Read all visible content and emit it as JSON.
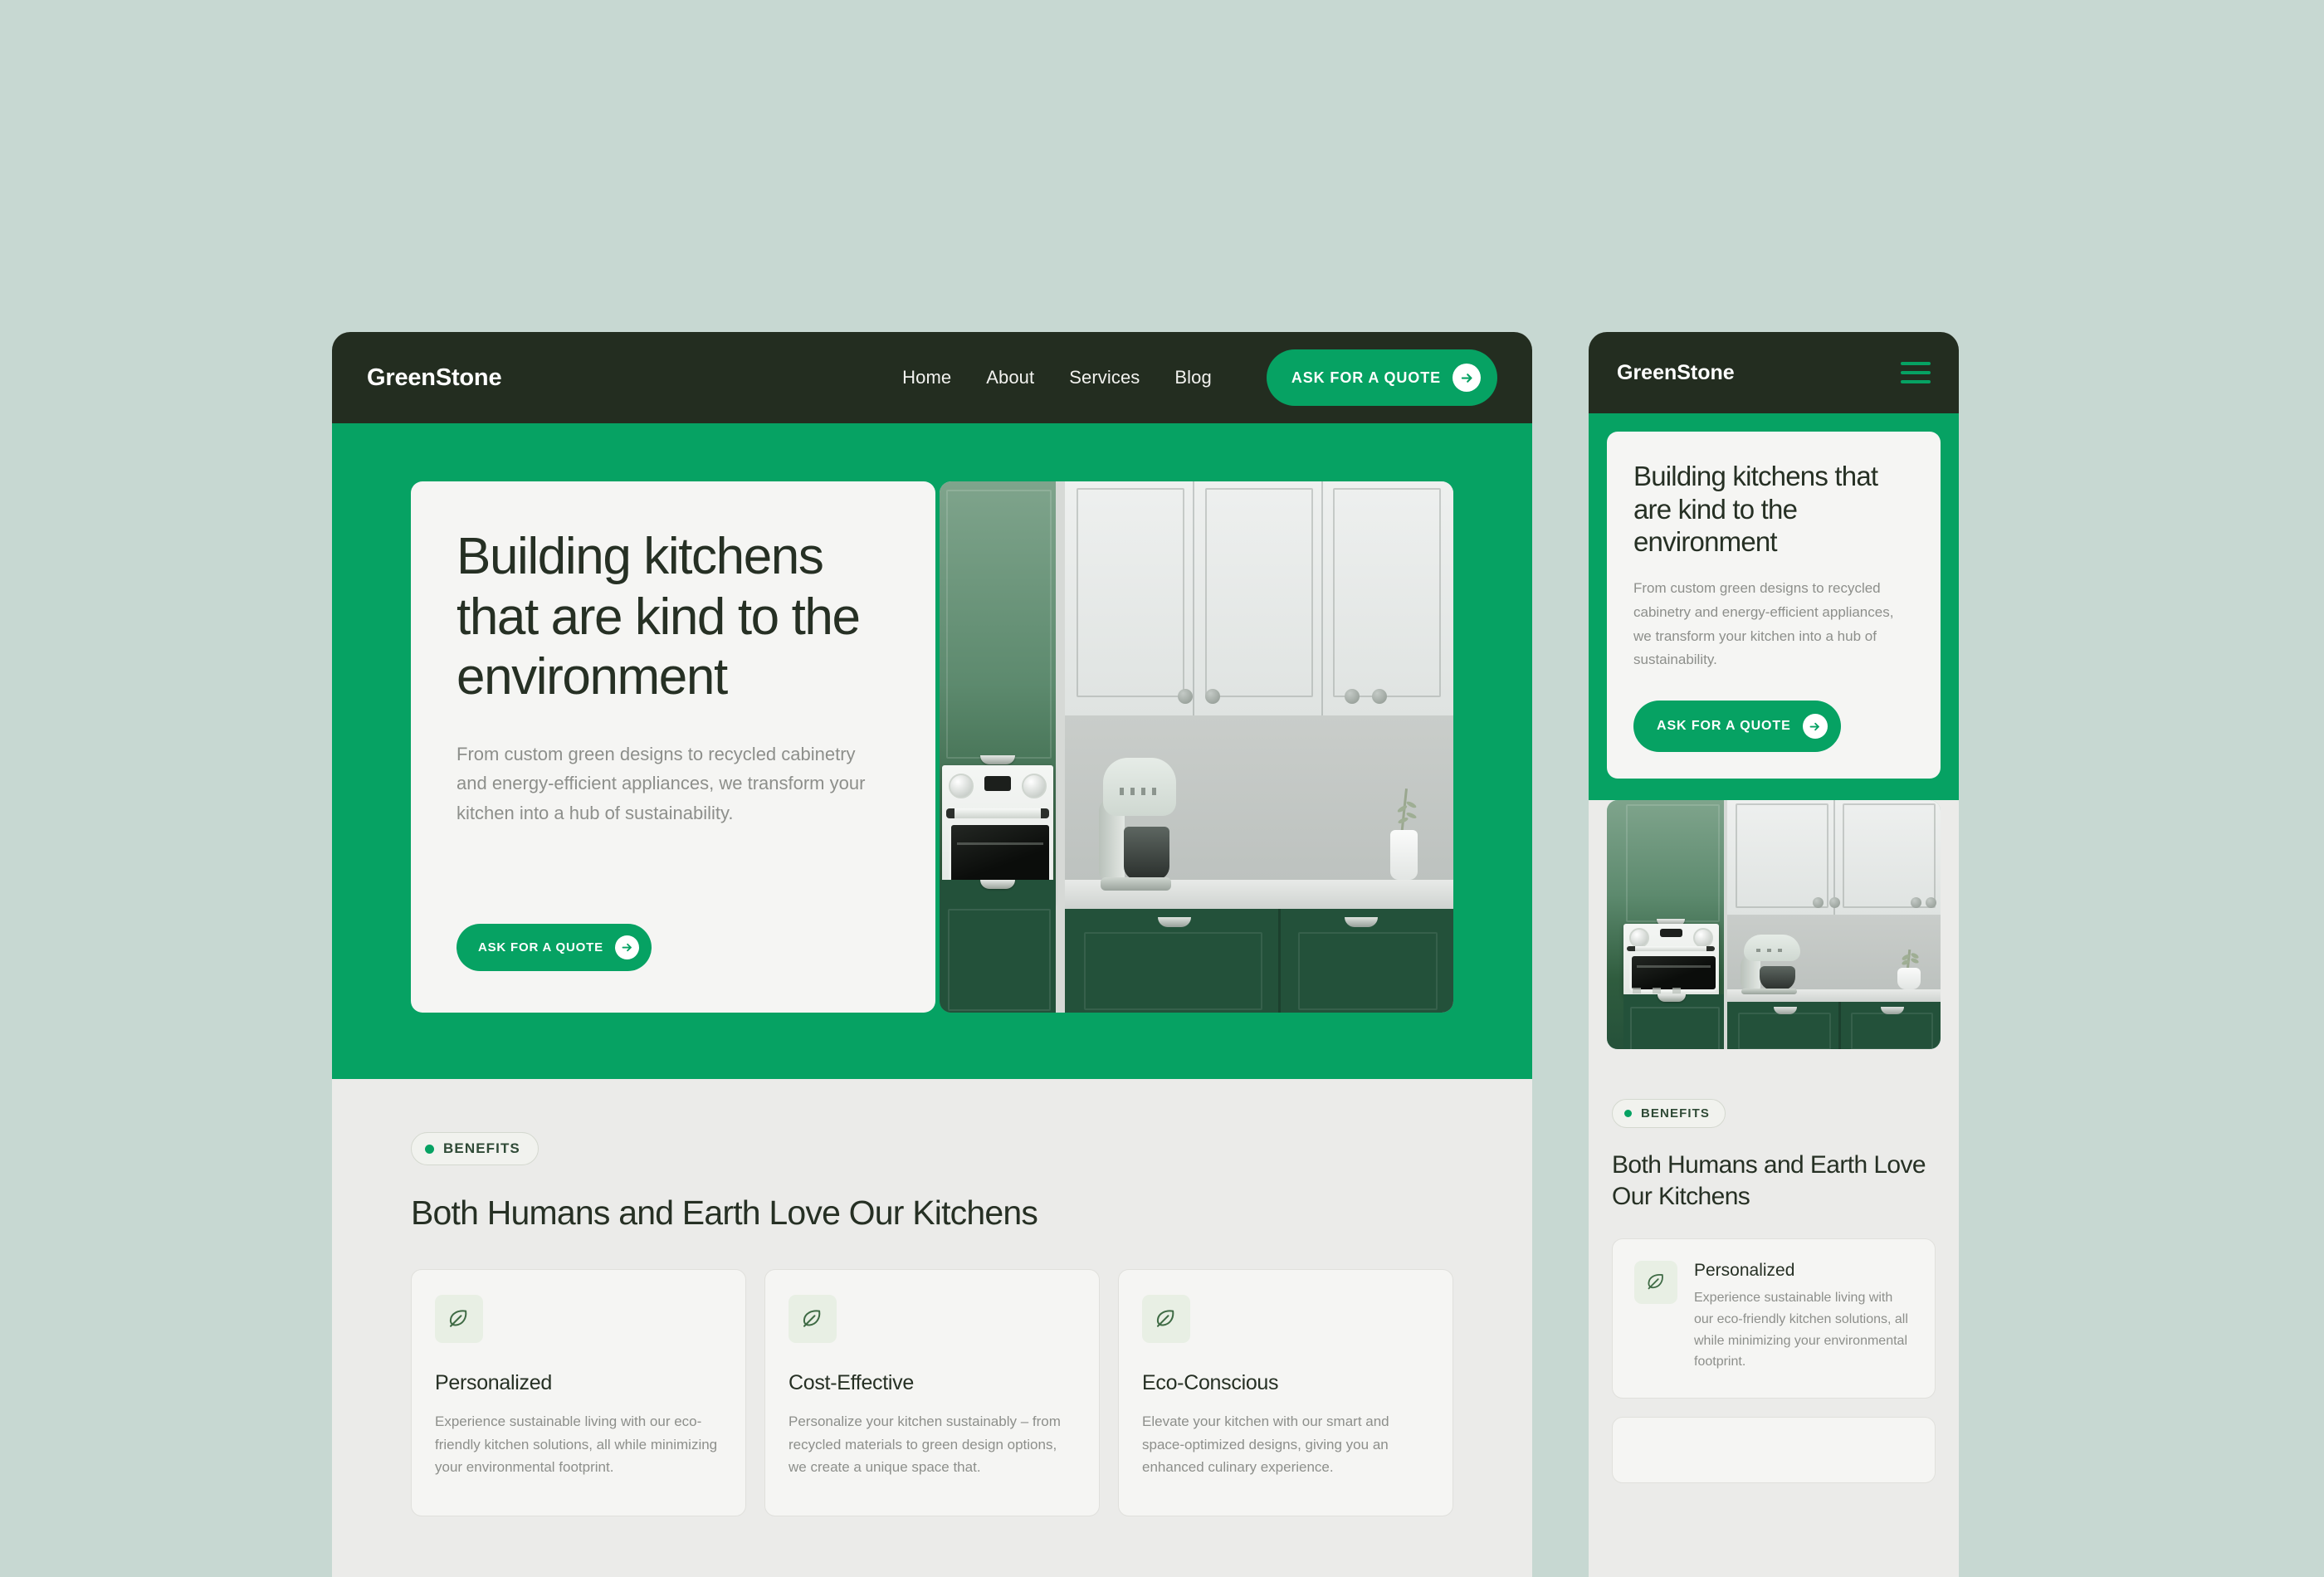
{
  "theme": {
    "page_background": "#c7d8d2",
    "brand_green": "#06a263",
    "header_dark": "#232d20",
    "section_background": "#ebebe9",
    "card_background": "#f5f5f3",
    "heading_color": "#263024",
    "body_text_color": "#8d8f8b"
  },
  "desktop": {
    "header": {
      "logo": "GreenStone",
      "nav": [
        {
          "label": "Home"
        },
        {
          "label": "About"
        },
        {
          "label": "Services"
        },
        {
          "label": "Blog"
        }
      ],
      "cta": {
        "label": "ASK FOR A QUOTE",
        "icon": "arrow-right-circle-icon"
      }
    },
    "hero": {
      "title": "Building kitchens that are kind to the environment",
      "subtitle": "From custom green designs to recycled cabinetry and energy-efficient appliances, we transform your kitchen into a hub of sustainability.",
      "cta": {
        "label": "ASK FOR A QUOTE",
        "icon": "arrow-right-circle-icon"
      },
      "image_alt": "green-and-white-kitchen-photo"
    },
    "benefits": {
      "badge": "BENEFITS",
      "title": "Both Humans and Earth Love Our Kitchens",
      "cards": [
        {
          "icon": "leaf-icon",
          "title": "Personalized",
          "body": "Experience sustainable living with our eco-friendly kitchen solutions, all while minimizing your environmental footprint."
        },
        {
          "icon": "leaf-icon",
          "title": "Cost-Effective",
          "body": "Personalize your kitchen sustainably – from recycled materials to green design options, we create a unique space that."
        },
        {
          "icon": "leaf-icon",
          "title": "Eco-Conscious",
          "body": "Elevate your kitchen with our smart and space-optimized designs, giving you an enhanced culinary experience."
        }
      ]
    }
  },
  "mobile": {
    "header": {
      "logo": "GreenStone",
      "menu_icon": "hamburger-menu-icon"
    },
    "hero": {
      "title": "Building kitchens that are kind to the environment",
      "subtitle": "From custom green designs to recycled cabinetry and energy-efficient appliances, we transform your kitchen into a hub of sustainability.",
      "cta": {
        "label": "ASK FOR A QUOTE",
        "icon": "arrow-right-circle-icon"
      },
      "image_alt": "green-and-white-kitchen-photo"
    },
    "benefits": {
      "badge": "BENEFITS",
      "title": "Both Humans and Earth Love Our Kitchens",
      "cards": [
        {
          "icon": "leaf-icon",
          "title": "Personalized",
          "body": "Experience sustainable living with our eco-friendly kitchen solutions, all while minimizing your environmental footprint."
        }
      ]
    }
  }
}
